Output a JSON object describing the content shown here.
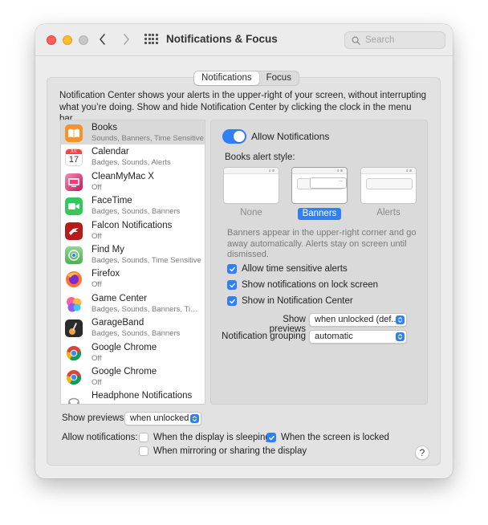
{
  "window": {
    "title": "Notifications & Focus",
    "search_placeholder": "Search"
  },
  "tabs": [
    {
      "label": "Notifications",
      "active": true
    },
    {
      "label": "Focus",
      "active": false
    }
  ],
  "intro_text": "Notification Center shows your alerts in the upper-right of your screen, without interrupting what you’re doing. Show and hide Notification Center by clicking the clock in the menu bar.",
  "apps": [
    {
      "name": "Books",
      "detail": "Sounds, Banners, Time Sensitive",
      "icon": "books-icon",
      "selected": true
    },
    {
      "name": "Calendar",
      "detail": "Badges, Sounds, Alerts",
      "icon": "calendar-icon",
      "calendar_month": "JUL",
      "calendar_day": "17"
    },
    {
      "name": "CleanMyMac X",
      "detail": "Off",
      "icon": "cleanmymac-icon"
    },
    {
      "name": "FaceTime",
      "detail": "Badges, Sounds, Banners",
      "icon": "facetime-icon"
    },
    {
      "name": "Falcon Notifications",
      "detail": "Off",
      "icon": "falcon-icon"
    },
    {
      "name": "Find My",
      "detail": "Badges, Sounds, Time Sensitive",
      "icon": "findmy-icon"
    },
    {
      "name": "Firefox",
      "detail": "Off",
      "icon": "firefox-icon"
    },
    {
      "name": "Game Center",
      "detail": "Badges, Sounds, Banners, Time Sensitive",
      "icon": "gamecenter-icon"
    },
    {
      "name": "GarageBand",
      "detail": "Badges, Sounds, Banners",
      "icon": "garageband-icon"
    },
    {
      "name": "Google Chrome",
      "detail": "Off",
      "icon": "chrome-icon"
    },
    {
      "name": "Google Chrome",
      "detail": "Off",
      "icon": "chrome-icon"
    },
    {
      "name": "Headphone Notifications",
      "detail": "",
      "icon": "headphone-icon"
    }
  ],
  "detail_panel": {
    "allow_label": "Allow Notifications",
    "allow_on": true,
    "style_label": "Books alert style:",
    "styles": [
      {
        "label": "None",
        "active": false
      },
      {
        "label": "Banners",
        "active": true
      },
      {
        "label": "Alerts",
        "active": false
      }
    ],
    "banner_description": "Banners appear in the upper-right corner and go away automatically. Alerts stay on screen until dismissed.",
    "checkboxes": [
      {
        "label": "Allow time sensitive alerts",
        "checked": true
      },
      {
        "label": "Show notifications on lock screen",
        "checked": true
      },
      {
        "label": "Show in Notification Center",
        "checked": true
      }
    ],
    "show_previews_label": "Show previews",
    "show_previews_value": "when unlocked (def...",
    "grouping_label": "Notification grouping",
    "grouping_value": "automatic"
  },
  "bottom": {
    "show_previews_label": "Show previews:",
    "show_previews_value": "when unlocked",
    "allow_label": "Allow notifications:",
    "options": [
      {
        "label": "When the display is sleeping",
        "checked": false
      },
      {
        "label": "When the screen is locked",
        "checked": true
      },
      {
        "label": "When mirroring or sharing the display",
        "checked": false
      }
    ],
    "help": "?"
  },
  "colors": {
    "accent": "#2f7ff7",
    "close": "#fe5f57",
    "minimize": "#febc2e"
  }
}
